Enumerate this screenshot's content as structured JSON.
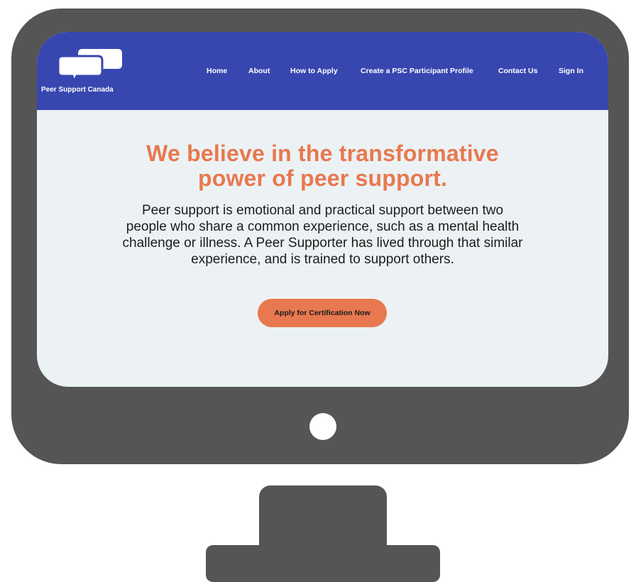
{
  "brand": {
    "name": "Peer Support Canada"
  },
  "nav": {
    "items": [
      {
        "label": "Home"
      },
      {
        "label": "About"
      },
      {
        "label": "How to Apply"
      },
      {
        "label": "Create a PSC Participant Profile"
      },
      {
        "label": "Contact Us"
      },
      {
        "label": "Sign In"
      }
    ]
  },
  "hero": {
    "title_line1": "We believe in the transformative",
    "title_line2": "power of peer support.",
    "body_line1": "Peer support is emotional and practical support between two",
    "body_line2": "people who share a common experience, such as a mental health",
    "body_line3": "challenge or illness. A Peer Supporter has lived through that similar",
    "body_line4": "experience, and is trained to support others.",
    "cta_label": "Apply for Certification Now"
  },
  "colors": {
    "nav_bg": "#3847b0",
    "accent": "#e8784f",
    "screen_bg": "#ecf2f4",
    "monitor": "#555555"
  },
  "icons": {
    "logo": "speech-bubbles-icon",
    "power": "power-button"
  }
}
